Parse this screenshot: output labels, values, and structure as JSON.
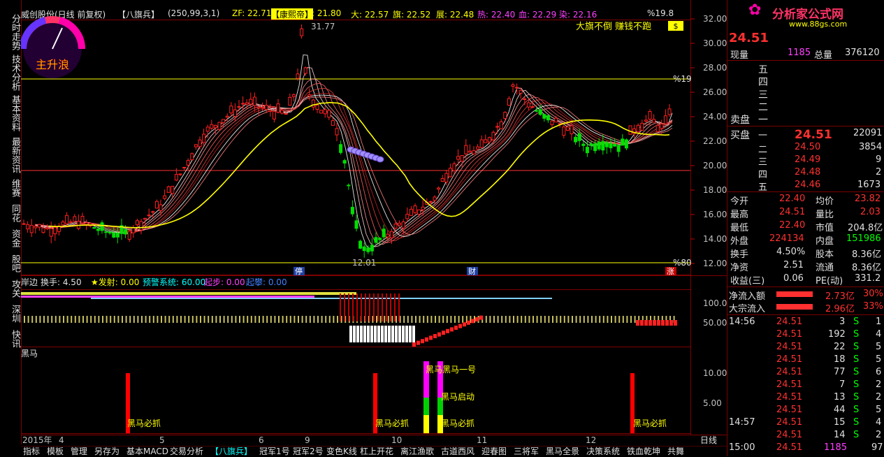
{
  "header": {
    "stock": "威创股份(日线 前复权)",
    "formula": "【八旗兵】",
    "params": "(250,99,3,1)",
    "zf_label": "ZF: 22.71",
    "kxd_label": "【康熙帝】",
    "kxd_value": ": 21.80",
    "da": "大: 22.57",
    "qi": "旗: 22.52",
    "zhan": "展: 22.48",
    "re": "热: 22.40",
    "xue": "血: 22.29",
    "ran": "染: 22.16",
    "pct": "%19.8"
  },
  "left_tabs": [
    "分时走势",
    "技术分析",
    "基本资料",
    "最新资讯",
    "维赛",
    "同花",
    "资金",
    "股吧",
    "攻关",
    "深圳",
    "快讯"
  ],
  "main_chart": {
    "y_ticks": [
      "32.00",
      "30.00",
      "28.00",
      "26.00",
      "24.00",
      "22.00",
      "20.00",
      "18.00",
      "16.00",
      "14.00",
      "12.00"
    ],
    "y_values": [
      32,
      30,
      28,
      26,
      24,
      22,
      20,
      18,
      16,
      14,
      12
    ],
    "gauge_label": "主升浪",
    "high_label": "31.77",
    "low_label": "12.01",
    "slogan": "大旗不倒 赚钱不跑",
    "pct_top": "%19",
    "pct_bottom": "%80",
    "marker_ting": "停",
    "marker_cai": "财",
    "marker_zhang": "涨",
    "money_icon": "$"
  },
  "sub1": {
    "label_a": "岸边",
    "label_b": "换手: 4.50",
    "label_c": "★发射: 0.00",
    "label_d": "预警系统: 60.00",
    "label_e": "起步: 0.00",
    "label_f": "起攀: 0.00",
    "y_ticks": [
      "100.0",
      "50.00"
    ]
  },
  "sub2": {
    "label": "黑马",
    "y_ticks": [
      "10.00",
      "5.00"
    ],
    "ann_must": "黑马必抓",
    "ann_one": "黑马黑马一号",
    "ann_start": "黑马启动"
  },
  "x_axis": [
    "2015年",
    "4",
    "5",
    "6",
    "9",
    "10",
    "11",
    "12"
  ],
  "x_axis_right": "日线",
  "right_panel": {
    "logo": "分析家公式网",
    "logo_url": "www.88gs.com",
    "price_big": "24.51",
    "xianliang_label": "现量",
    "xianliang": "1185",
    "zongliang_label": "总量",
    "zongliang": "376120",
    "sell_labels": [
      "五",
      "四",
      "三",
      "二",
      "一"
    ],
    "sell_side_label": "卖盘",
    "buy_side_label": "买盘",
    "buy_rows": [
      {
        "level": "一",
        "price": "24.51",
        "vol": "22091"
      },
      {
        "level": "二",
        "price": "24.50",
        "vol": "3854"
      },
      {
        "level": "三",
        "price": "24.49",
        "vol": "9"
      },
      {
        "level": "四",
        "price": "24.48",
        "vol": "2"
      },
      {
        "level": "五",
        "price": "24.46",
        "vol": "1673"
      }
    ],
    "stats": [
      {
        "l1": "今开",
        "v1": "22.40",
        "l2": "均价",
        "v2": "23.82"
      },
      {
        "l1": "最高",
        "v1": "24.51",
        "l2": "量比",
        "v2": "2.03"
      },
      {
        "l1": "最低",
        "v1": "22.40",
        "l2": "市值",
        "v2": "204.8亿"
      },
      {
        "l1": "外盘",
        "v1": "224134",
        "l2": "内盘",
        "v2": "151986"
      },
      {
        "l1": "换手",
        "v1": "4.50%",
        "l2": "股本",
        "v2": "8.36亿"
      },
      {
        "l1": "净资",
        "v1": "2.51",
        "l2": "流通",
        "v2": "8.36亿"
      },
      {
        "l1": "收益(三)",
        "v1": "0.06",
        "l2": "PE(动)",
        "v2": "331.2"
      }
    ],
    "flow": [
      {
        "label": "净流入额",
        "value": "2.73亿",
        "pct": "30%"
      },
      {
        "label": "大宗流入",
        "value": "2.96亿",
        "pct": "33%"
      }
    ],
    "ticks": [
      {
        "time": "14:56",
        "price": "24.51",
        "vol": "3",
        "side": "S",
        "n": "1"
      },
      {
        "time": "",
        "price": "24.51",
        "vol": "192",
        "side": "S",
        "n": "4"
      },
      {
        "time": "",
        "price": "24.51",
        "vol": "22",
        "side": "S",
        "n": "5"
      },
      {
        "time": "",
        "price": "24.51",
        "vol": "18",
        "side": "S",
        "n": "5"
      },
      {
        "time": "",
        "price": "24.51",
        "vol": "77",
        "side": "S",
        "n": "6"
      },
      {
        "time": "",
        "price": "24.51",
        "vol": "7",
        "side": "S",
        "n": "2"
      },
      {
        "time": "",
        "price": "24.51",
        "vol": "13",
        "side": "S",
        "n": "2"
      },
      {
        "time": "",
        "price": "24.51",
        "vol": "44",
        "side": "S",
        "n": "5"
      },
      {
        "time": "14:57",
        "price": "24.51",
        "vol": "15",
        "side": "S",
        "n": "4"
      },
      {
        "time": "",
        "price": "24.51",
        "vol": "14",
        "side": "S",
        "n": "2"
      },
      {
        "time": "15:00",
        "price": "24.51",
        "vol": "1185",
        "side": "",
        "n": "97"
      }
    ]
  },
  "bottom_tabs": [
    "指标",
    "模板",
    "管理",
    "另存为",
    "基本MACD",
    "交易分析",
    "【八旗兵】",
    "冠军1号",
    "冠军2号",
    "变色K线",
    "杠上开花",
    "离江渔歌",
    "古道西风",
    "迎春图",
    "三将军",
    "黑马全景",
    "决策系统",
    "铁血乾坤",
    "共舞"
  ],
  "colors": {
    "up": "#ff2020",
    "down": "#00e000",
    "yellow": "#ffff00",
    "grid": "#800000"
  }
}
